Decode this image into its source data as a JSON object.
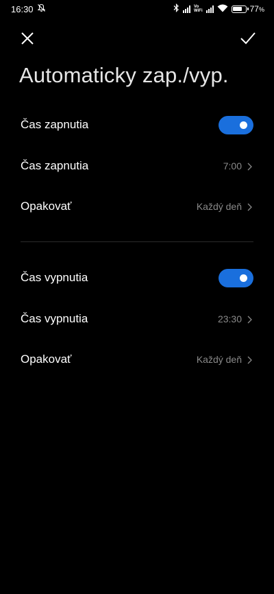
{
  "status_bar": {
    "time": "16:30",
    "battery_percent": "77",
    "battery_unit": "%",
    "volte_top": "Vo",
    "volte_bottom": "WiFi",
    "icons": [
      "mute-bell-icon",
      "bluetooth-icon",
      "signal-icon",
      "vowifi-icon",
      "signal-icon",
      "wifi-icon",
      "battery-icon"
    ]
  },
  "header": {
    "close_icon": "close-icon",
    "confirm_icon": "check-icon",
    "title": "Automaticky zap./vyp."
  },
  "power_on": {
    "toggle_label": "Čas zapnutia",
    "toggle_on": true,
    "time_label": "Čas zapnutia",
    "time_value": "7:00",
    "repeat_label": "Opakovať",
    "repeat_value": "Každý deň"
  },
  "power_off": {
    "toggle_label": "Čas vypnutia",
    "toggle_on": true,
    "time_label": "Čas vypnutia",
    "time_value": "23:30",
    "repeat_label": "Opakovať",
    "repeat_value": "Každý deň"
  },
  "colors": {
    "background": "#000000",
    "accent": "#1a6fdd",
    "secondary_text": "#8a8a8a",
    "divider": "#2c2c2c"
  }
}
